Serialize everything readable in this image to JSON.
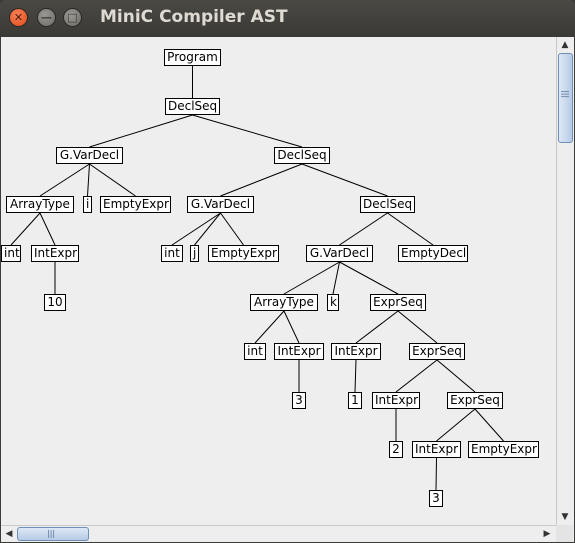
{
  "window": {
    "title": "MiniC Compiler AST",
    "close_glyph": "✕",
    "minimize_glyph": "—",
    "maximize_glyph": "□"
  },
  "tree": {
    "nodes": [
      {
        "id": "program",
        "label": "Program"
      },
      {
        "id": "declseq-1",
        "label": "DeclSeq"
      },
      {
        "id": "gvardecl-1",
        "label": "G.VarDecl"
      },
      {
        "id": "declseq-2",
        "label": "DeclSeq"
      },
      {
        "id": "arraytype-1",
        "label": "ArrayType"
      },
      {
        "id": "ident-i",
        "label": "i"
      },
      {
        "id": "emptyexpr-1",
        "label": "EmptyExpr"
      },
      {
        "id": "gvardecl-2",
        "label": "G.VarDecl"
      },
      {
        "id": "declseq-3",
        "label": "DeclSeq"
      },
      {
        "id": "int-1",
        "label": "int"
      },
      {
        "id": "intexpr-1",
        "label": "IntExpr"
      },
      {
        "id": "int-2",
        "label": "int"
      },
      {
        "id": "ident-j",
        "label": "j"
      },
      {
        "id": "emptyexpr-2",
        "label": "EmptyExpr"
      },
      {
        "id": "gvardecl-3",
        "label": "G.VarDecl"
      },
      {
        "id": "emptydecl-1",
        "label": "EmptyDecl"
      },
      {
        "id": "lit-10",
        "label": "10"
      },
      {
        "id": "arraytype-2",
        "label": "ArrayType"
      },
      {
        "id": "ident-k",
        "label": "k"
      },
      {
        "id": "exprseq-1",
        "label": "ExprSeq"
      },
      {
        "id": "int-3",
        "label": "int"
      },
      {
        "id": "intexpr-2",
        "label": "IntExpr"
      },
      {
        "id": "intexpr-3",
        "label": "IntExpr"
      },
      {
        "id": "exprseq-2",
        "label": "ExprSeq"
      },
      {
        "id": "lit-3a",
        "label": "3"
      },
      {
        "id": "lit-1",
        "label": "1"
      },
      {
        "id": "intexpr-4",
        "label": "IntExpr"
      },
      {
        "id": "exprseq-3",
        "label": "ExprSeq"
      },
      {
        "id": "lit-2",
        "label": "2"
      },
      {
        "id": "intexpr-5",
        "label": "IntExpr"
      },
      {
        "id": "emptyexpr-3",
        "label": "EmptyExpr"
      },
      {
        "id": "lit-3b",
        "label": "3"
      }
    ],
    "edges": [
      [
        "program",
        "declseq-1"
      ],
      [
        "declseq-1",
        "gvardecl-1"
      ],
      [
        "declseq-1",
        "declseq-2"
      ],
      [
        "gvardecl-1",
        "arraytype-1"
      ],
      [
        "gvardecl-1",
        "ident-i"
      ],
      [
        "gvardecl-1",
        "emptyexpr-1"
      ],
      [
        "declseq-2",
        "gvardecl-2"
      ],
      [
        "declseq-2",
        "declseq-3"
      ],
      [
        "arraytype-1",
        "int-1"
      ],
      [
        "arraytype-1",
        "intexpr-1"
      ],
      [
        "intexpr-1",
        "lit-10"
      ],
      [
        "gvardecl-2",
        "int-2"
      ],
      [
        "gvardecl-2",
        "ident-j"
      ],
      [
        "gvardecl-2",
        "emptyexpr-2"
      ],
      [
        "declseq-3",
        "gvardecl-3"
      ],
      [
        "declseq-3",
        "emptydecl-1"
      ],
      [
        "gvardecl-3",
        "arraytype-2"
      ],
      [
        "gvardecl-3",
        "ident-k"
      ],
      [
        "gvardecl-3",
        "exprseq-1"
      ],
      [
        "arraytype-2",
        "int-3"
      ],
      [
        "arraytype-2",
        "intexpr-2"
      ],
      [
        "intexpr-2",
        "lit-3a"
      ],
      [
        "exprseq-1",
        "intexpr-3"
      ],
      [
        "exprseq-1",
        "exprseq-2"
      ],
      [
        "intexpr-3",
        "lit-1"
      ],
      [
        "exprseq-2",
        "intexpr-4"
      ],
      [
        "exprseq-2",
        "exprseq-3"
      ],
      [
        "intexpr-4",
        "lit-2"
      ],
      [
        "exprseq-3",
        "intexpr-5"
      ],
      [
        "exprseq-3",
        "emptyexpr-3"
      ],
      [
        "intexpr-5",
        "lit-3b"
      ]
    ]
  },
  "scrollbars": {
    "up_icon": "up-arrow-icon",
    "down_icon": "down-arrow-icon",
    "left_icon": "left-arrow-icon",
    "right_icon": "right-arrow-icon",
    "up_glyph": "▲",
    "down_glyph": "▼",
    "left_glyph": "◀",
    "right_glyph": "▶",
    "grip_glyph": "|||"
  }
}
